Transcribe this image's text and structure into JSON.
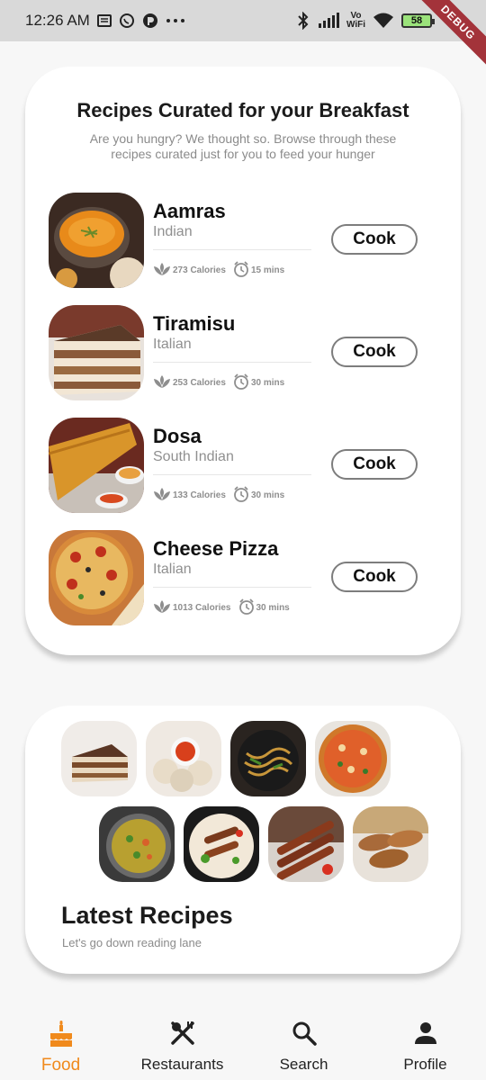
{
  "status_bar": {
    "time": "12:26 AM",
    "battery": "58",
    "debug_label": "DEBUG",
    "icons": [
      "notes-icon",
      "whatsapp-icon",
      "app-icon",
      "more-dots-icon",
      "bluetooth-icon",
      "signal-icon",
      "vowifi-icon",
      "wifi-icon",
      "battery-icon"
    ],
    "vowifi_top": "Vo",
    "vowifi_bottom": "WiFi"
  },
  "breakfast": {
    "title": "Recipes Curated for your Breakfast",
    "subtitle": "Are you hungry? We thought so. Browse through these recipes curated just for you to feed your hunger",
    "cook_label": "Cook",
    "recipes": [
      {
        "name": "Aamras",
        "cuisine": "Indian",
        "calories": "273 Calories",
        "time": "15 mins"
      },
      {
        "name": "Tiramisu",
        "cuisine": "Italian",
        "calories": "253 Calories",
        "time": "30 mins"
      },
      {
        "name": "Dosa",
        "cuisine": "South Indian",
        "calories": "133 Calories",
        "time": "30 mins"
      },
      {
        "name": "Cheese Pizza",
        "cuisine": "Italian",
        "calories": "1013 Calories",
        "time": "30 mins"
      }
    ]
  },
  "latest": {
    "title": "Latest Recipes",
    "subtitle": "Let's go down reading lane"
  },
  "nav": {
    "items": [
      {
        "label": "Food",
        "icon": "cake-icon"
      },
      {
        "label": "Restaurants",
        "icon": "utensils-icon"
      },
      {
        "label": "Search",
        "icon": "search-icon"
      },
      {
        "label": "Profile",
        "icon": "person-icon"
      }
    ]
  },
  "colors": {
    "accent": "#f08a1c",
    "status_bar": "#d9d9d9",
    "debug_ribbon": "#a3333a"
  }
}
